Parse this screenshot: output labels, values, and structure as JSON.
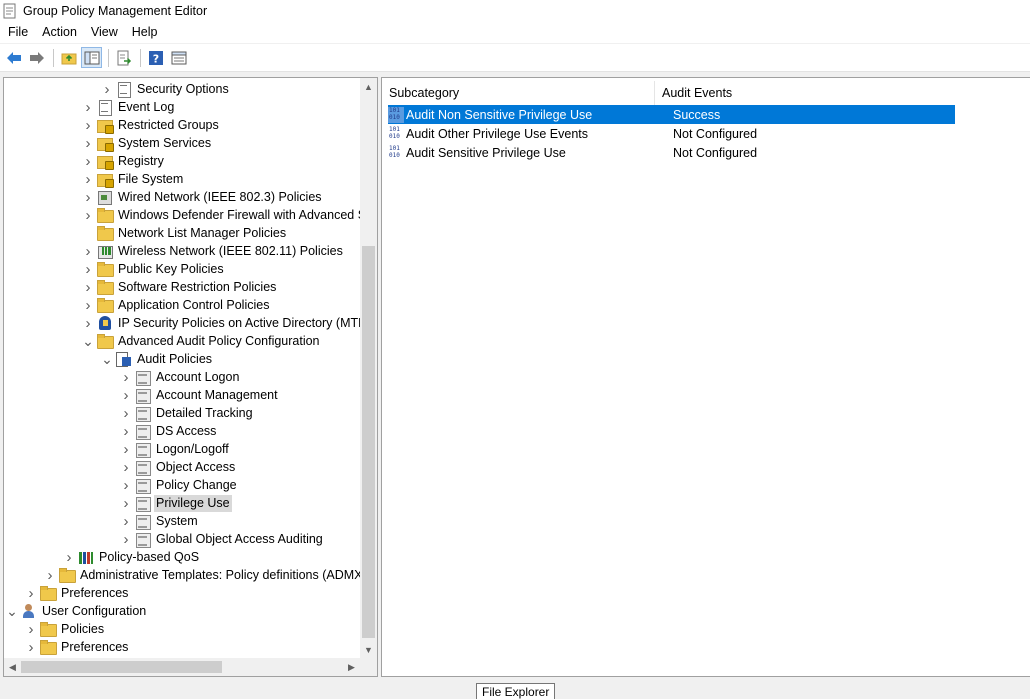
{
  "window": {
    "title": "Group Policy Management Editor"
  },
  "menu": [
    "File",
    "Action",
    "View",
    "Help"
  ],
  "toolbar": {
    "buttons": [
      "back-icon",
      "forward-icon",
      "up-folder-icon",
      "show-hide-tree-icon",
      "export-list-icon",
      "help-icon",
      "properties-view-icon"
    ]
  },
  "tree": {
    "nodes": [
      {
        "label": "Security Options",
        "icon": "doc",
        "depth": 6,
        "expander": "collapsed"
      },
      {
        "label": "Event Log",
        "icon": "doc",
        "depth": 5,
        "expander": "collapsed"
      },
      {
        "label": "Restricted Groups",
        "icon": "lockfolder",
        "depth": 5,
        "expander": "collapsed"
      },
      {
        "label": "System Services",
        "icon": "lockfolder",
        "depth": 5,
        "expander": "collapsed"
      },
      {
        "label": "Registry",
        "icon": "lockfolder",
        "depth": 5,
        "expander": "collapsed"
      },
      {
        "label": "File System",
        "icon": "lockfolder",
        "depth": 5,
        "expander": "collapsed"
      },
      {
        "label": "Wired Network (IEEE 802.3) Policies",
        "icon": "net",
        "depth": 5,
        "expander": "collapsed"
      },
      {
        "label": "Windows Defender Firewall with Advanced Se",
        "icon": "folder",
        "depth": 5,
        "expander": "collapsed"
      },
      {
        "label": "Network List Manager Policies",
        "icon": "folder",
        "depth": 5,
        "expander": "none"
      },
      {
        "label": "Wireless Network (IEEE 802.11) Policies",
        "icon": "wifi",
        "depth": 5,
        "expander": "collapsed"
      },
      {
        "label": "Public Key Policies",
        "icon": "folder",
        "depth": 5,
        "expander": "collapsed"
      },
      {
        "label": "Software Restriction Policies",
        "icon": "folder",
        "depth": 5,
        "expander": "collapsed"
      },
      {
        "label": "Application Control Policies",
        "icon": "folder",
        "depth": 5,
        "expander": "collapsed"
      },
      {
        "label": "IP Security Policies on Active Directory (MTLA",
        "icon": "ipsec",
        "depth": 5,
        "expander": "collapsed"
      },
      {
        "label": "Advanced Audit Policy Configuration",
        "icon": "folder",
        "depth": 5,
        "expander": "expanded"
      },
      {
        "label": "Audit Policies",
        "icon": "auditroot",
        "depth": 6,
        "expander": "expanded"
      },
      {
        "label": "Account Logon",
        "icon": "audit",
        "depth": 7,
        "expander": "collapsed"
      },
      {
        "label": "Account Management",
        "icon": "audit",
        "depth": 7,
        "expander": "collapsed"
      },
      {
        "label": "Detailed Tracking",
        "icon": "audit",
        "depth": 7,
        "expander": "collapsed"
      },
      {
        "label": "DS Access",
        "icon": "audit",
        "depth": 7,
        "expander": "collapsed"
      },
      {
        "label": "Logon/Logoff",
        "icon": "audit",
        "depth": 7,
        "expander": "collapsed"
      },
      {
        "label": "Object Access",
        "icon": "audit",
        "depth": 7,
        "expander": "collapsed"
      },
      {
        "label": "Policy Change",
        "icon": "audit",
        "depth": 7,
        "expander": "collapsed"
      },
      {
        "label": "Privilege Use",
        "icon": "audit",
        "depth": 7,
        "expander": "collapsed",
        "selected": true
      },
      {
        "label": "System",
        "icon": "audit",
        "depth": 7,
        "expander": "collapsed"
      },
      {
        "label": "Global Object Access Auditing",
        "icon": "audit",
        "depth": 7,
        "expander": "collapsed"
      },
      {
        "label": "Policy-based QoS",
        "icon": "qos",
        "depth": 4,
        "expander": "collapsed"
      },
      {
        "label": "Administrative Templates: Policy definitions (ADMX",
        "icon": "folder",
        "depth": 3,
        "expander": "collapsed"
      },
      {
        "label": "Preferences",
        "icon": "folder",
        "depth": 2,
        "expander": "collapsed"
      },
      {
        "label": "User Configuration",
        "icon": "user",
        "depth": 1,
        "expander": "expanded"
      },
      {
        "label": "Policies",
        "icon": "folder",
        "depth": 2,
        "expander": "collapsed"
      },
      {
        "label": "Preferences",
        "icon": "folder",
        "depth": 2,
        "expander": "collapsed"
      }
    ]
  },
  "list": {
    "columns": [
      "Subcategory",
      "Audit Events"
    ],
    "rows": [
      {
        "subcategory": "Audit Non Sensitive Privilege Use",
        "audit_events": "Success",
        "selected": true
      },
      {
        "subcategory": "Audit Other Privilege Use Events",
        "audit_events": "Not Configured"
      },
      {
        "subcategory": "Audit Sensitive Privilege Use",
        "audit_events": "Not Configured"
      }
    ]
  },
  "tooltip": "File Explorer"
}
